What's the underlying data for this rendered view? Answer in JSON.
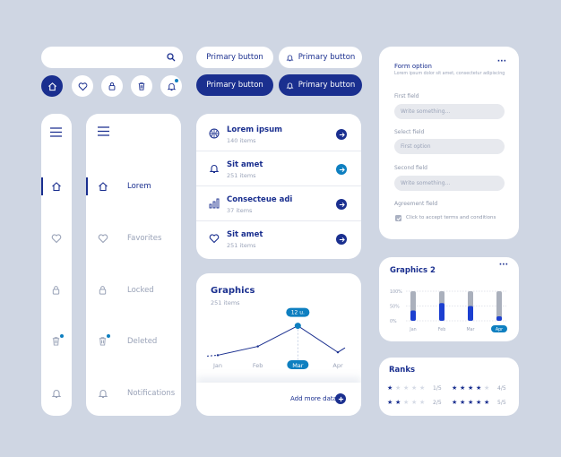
{
  "search": {
    "placeholder": ""
  },
  "buttons": {
    "primary_outline_1": "Primary button",
    "primary_outline_2": "Primary button",
    "primary_filled_1": "Primary button",
    "primary_filled_2": "Primary button"
  },
  "icon_row": [
    "home-icon",
    "heart-icon",
    "lock-icon",
    "trash-icon",
    "bell-icon"
  ],
  "sidebar_wide": {
    "items": [
      {
        "label": "Lorem",
        "icon": "home-icon",
        "active": true
      },
      {
        "label": "Favorites",
        "icon": "heart-icon"
      },
      {
        "label": "Locked",
        "icon": "lock-icon"
      },
      {
        "label": "Deleted",
        "icon": "trash-icon"
      },
      {
        "label": "Notifications",
        "icon": "bell-icon"
      }
    ]
  },
  "list": {
    "items": [
      {
        "title": "Lorem ipsum",
        "subtitle": "140 items",
        "icon": "basketball-icon",
        "arrow_color": "#1a2f8f"
      },
      {
        "title": "Sit amet",
        "subtitle": "251 items",
        "icon": "bell-icon",
        "arrow_color": "#0e7fc0"
      },
      {
        "title": "Consecteue adi",
        "subtitle": "37 items",
        "icon": "bar-chart-icon",
        "arrow_color": "#1a2f8f"
      },
      {
        "title": "Sit amet",
        "subtitle": "251 items",
        "icon": "heart-icon",
        "arrow_color": "#1a2f8f"
      }
    ]
  },
  "graphics": {
    "title": "Graphics",
    "subtitle": "251 items",
    "tooltip": "12 u.",
    "add_more": "Add more data"
  },
  "chart_data": [
    {
      "type": "line",
      "categories": [
        "Jan",
        "Feb",
        "Mar",
        "Apr"
      ],
      "series": [
        {
          "values": [
            2,
            5,
            12,
            3
          ]
        }
      ],
      "selected": "Mar",
      "ylim": [
        0,
        14
      ]
    },
    {
      "type": "bar",
      "title": "Graphics 2",
      "categories": [
        "Jan",
        "Feb",
        "Mar",
        "Apr"
      ],
      "yticks": [
        "100%",
        "50%",
        "0%"
      ],
      "values": [
        0.35,
        0.6,
        0.5,
        0.15
      ],
      "selected": "Apr",
      "ylim": [
        0,
        1
      ]
    }
  ],
  "form": {
    "title": "Form option",
    "subtitle": "Lorem ipsum dolor sit amet, consectetur adipiscing",
    "menu": "···",
    "first_label": "First field",
    "first_placeholder": "Write something...",
    "select_label": "Select field",
    "select_value": "First option",
    "second_label": "Second field",
    "second_placeholder": "Write something...",
    "agreement_label": "Agreement field",
    "checkbox_label": "Click to accept terms and conditions",
    "checked": true
  },
  "ranks": {
    "title": "Ranks",
    "items": [
      {
        "stars": 1,
        "label": "1/5"
      },
      {
        "stars": 4,
        "label": "4/5"
      },
      {
        "stars": 2,
        "label": "2/5"
      },
      {
        "stars": 5,
        "label": "5/5"
      }
    ]
  },
  "colors": {
    "primary": "#1a2f8f",
    "accent": "#0e7fc0",
    "muted": "#9aa3b8",
    "background": "#cfd6e3"
  }
}
